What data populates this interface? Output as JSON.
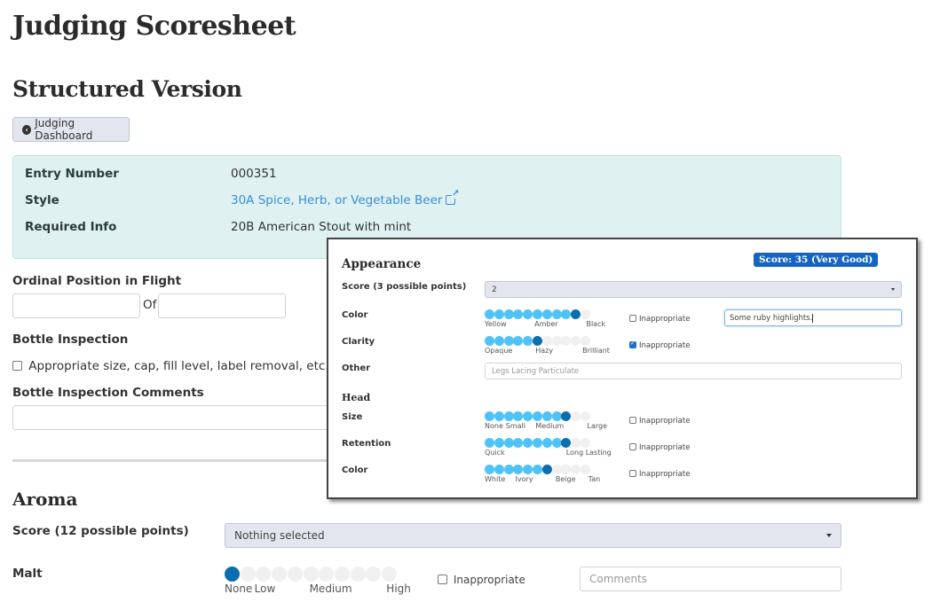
{
  "page": {
    "title": "Judging Scoresheet",
    "subtitle": "Structured Version",
    "dashboard_button": {
      "label": "Judging Dashboard",
      "icon": "chevron-circle-left-icon"
    }
  },
  "entry_info": {
    "rows": [
      {
        "label": "Entry Number",
        "value": "000351",
        "is_link": false
      },
      {
        "label": "Style",
        "value": "30A Spice, Herb, or Vegetable Beer",
        "is_link": true,
        "icon": "external-link-icon"
      },
      {
        "label": "Required Info",
        "value": "20B American Stout with mint",
        "is_link": false
      }
    ],
    "link_color": "#3a8fd6",
    "panel_color": "#dff1f1"
  },
  "ordinal": {
    "label": "Ordinal Position in Flight",
    "position_value": "",
    "of_label": "Of",
    "total_value": ""
  },
  "bottle_inspection": {
    "label": "Bottle Inspection",
    "checkbox_label": "Appropriate size, cap, fill level, label removal, etc.",
    "checked": false,
    "comments_label": "Bottle Inspection Comments",
    "comments_value": ""
  },
  "aroma": {
    "heading": "Aroma",
    "score_label": "Score (12 possible points)",
    "score_value": "Nothing selected",
    "malt": {
      "label": "Malt",
      "steps": 11,
      "value_index": 0,
      "tick_labels": [
        "None",
        "Low",
        "Medium",
        "High"
      ],
      "inappropriate_label": "Inappropriate",
      "inappropriate_checked": false,
      "comments_placeholder": "Comments",
      "comments_value": ""
    }
  },
  "popup": {
    "score_badge": "Score: 35 (Very Good)",
    "badge_color": "#1565c0",
    "appearance": {
      "heading": "Appearance",
      "score_label": "Score (3 possible points)",
      "score_value": "2",
      "color": {
        "label": "Color",
        "steps": 11,
        "value_index": 9,
        "tick_labels": [
          "Yellow",
          "Amber",
          "Black"
        ],
        "inappropriate_label": "Inappropriate",
        "inappropriate_checked": false,
        "comments_value": "Some ruby highlights."
      },
      "clarity": {
        "label": "Clarity",
        "steps": 11,
        "value_index": 5,
        "tick_labels": [
          "Opaque",
          "Hazy",
          "Brilliant"
        ],
        "inappropriate_label": "Inappropriate",
        "inappropriate_checked": true
      },
      "other": {
        "label": "Other",
        "placeholder": "Legs Lacing Particulate",
        "value": ""
      }
    },
    "head": {
      "heading": "Head",
      "size": {
        "label": "Size",
        "steps": 11,
        "value_index": 8,
        "tick_labels": [
          "None",
          "Small",
          "Medium",
          "Large"
        ],
        "inappropriate_label": "Inappropriate",
        "inappropriate_checked": false
      },
      "retention": {
        "label": "Retention",
        "steps": 11,
        "value_index": 8,
        "tick_labels": [
          "Quick",
          "Long Lasting"
        ],
        "inappropriate_label": "Inappropriate",
        "inappropriate_checked": false
      },
      "color": {
        "label": "Color",
        "steps": 11,
        "value_index": 6,
        "tick_labels": [
          "White",
          "Ivory",
          "Beige",
          "Tan"
        ],
        "inappropriate_label": "Inappropriate",
        "inappropriate_checked": false
      }
    }
  },
  "slider_colors": {
    "filled": "#4fc3f7",
    "active": "#0d6eaf",
    "empty": "#f0f0f0"
  }
}
